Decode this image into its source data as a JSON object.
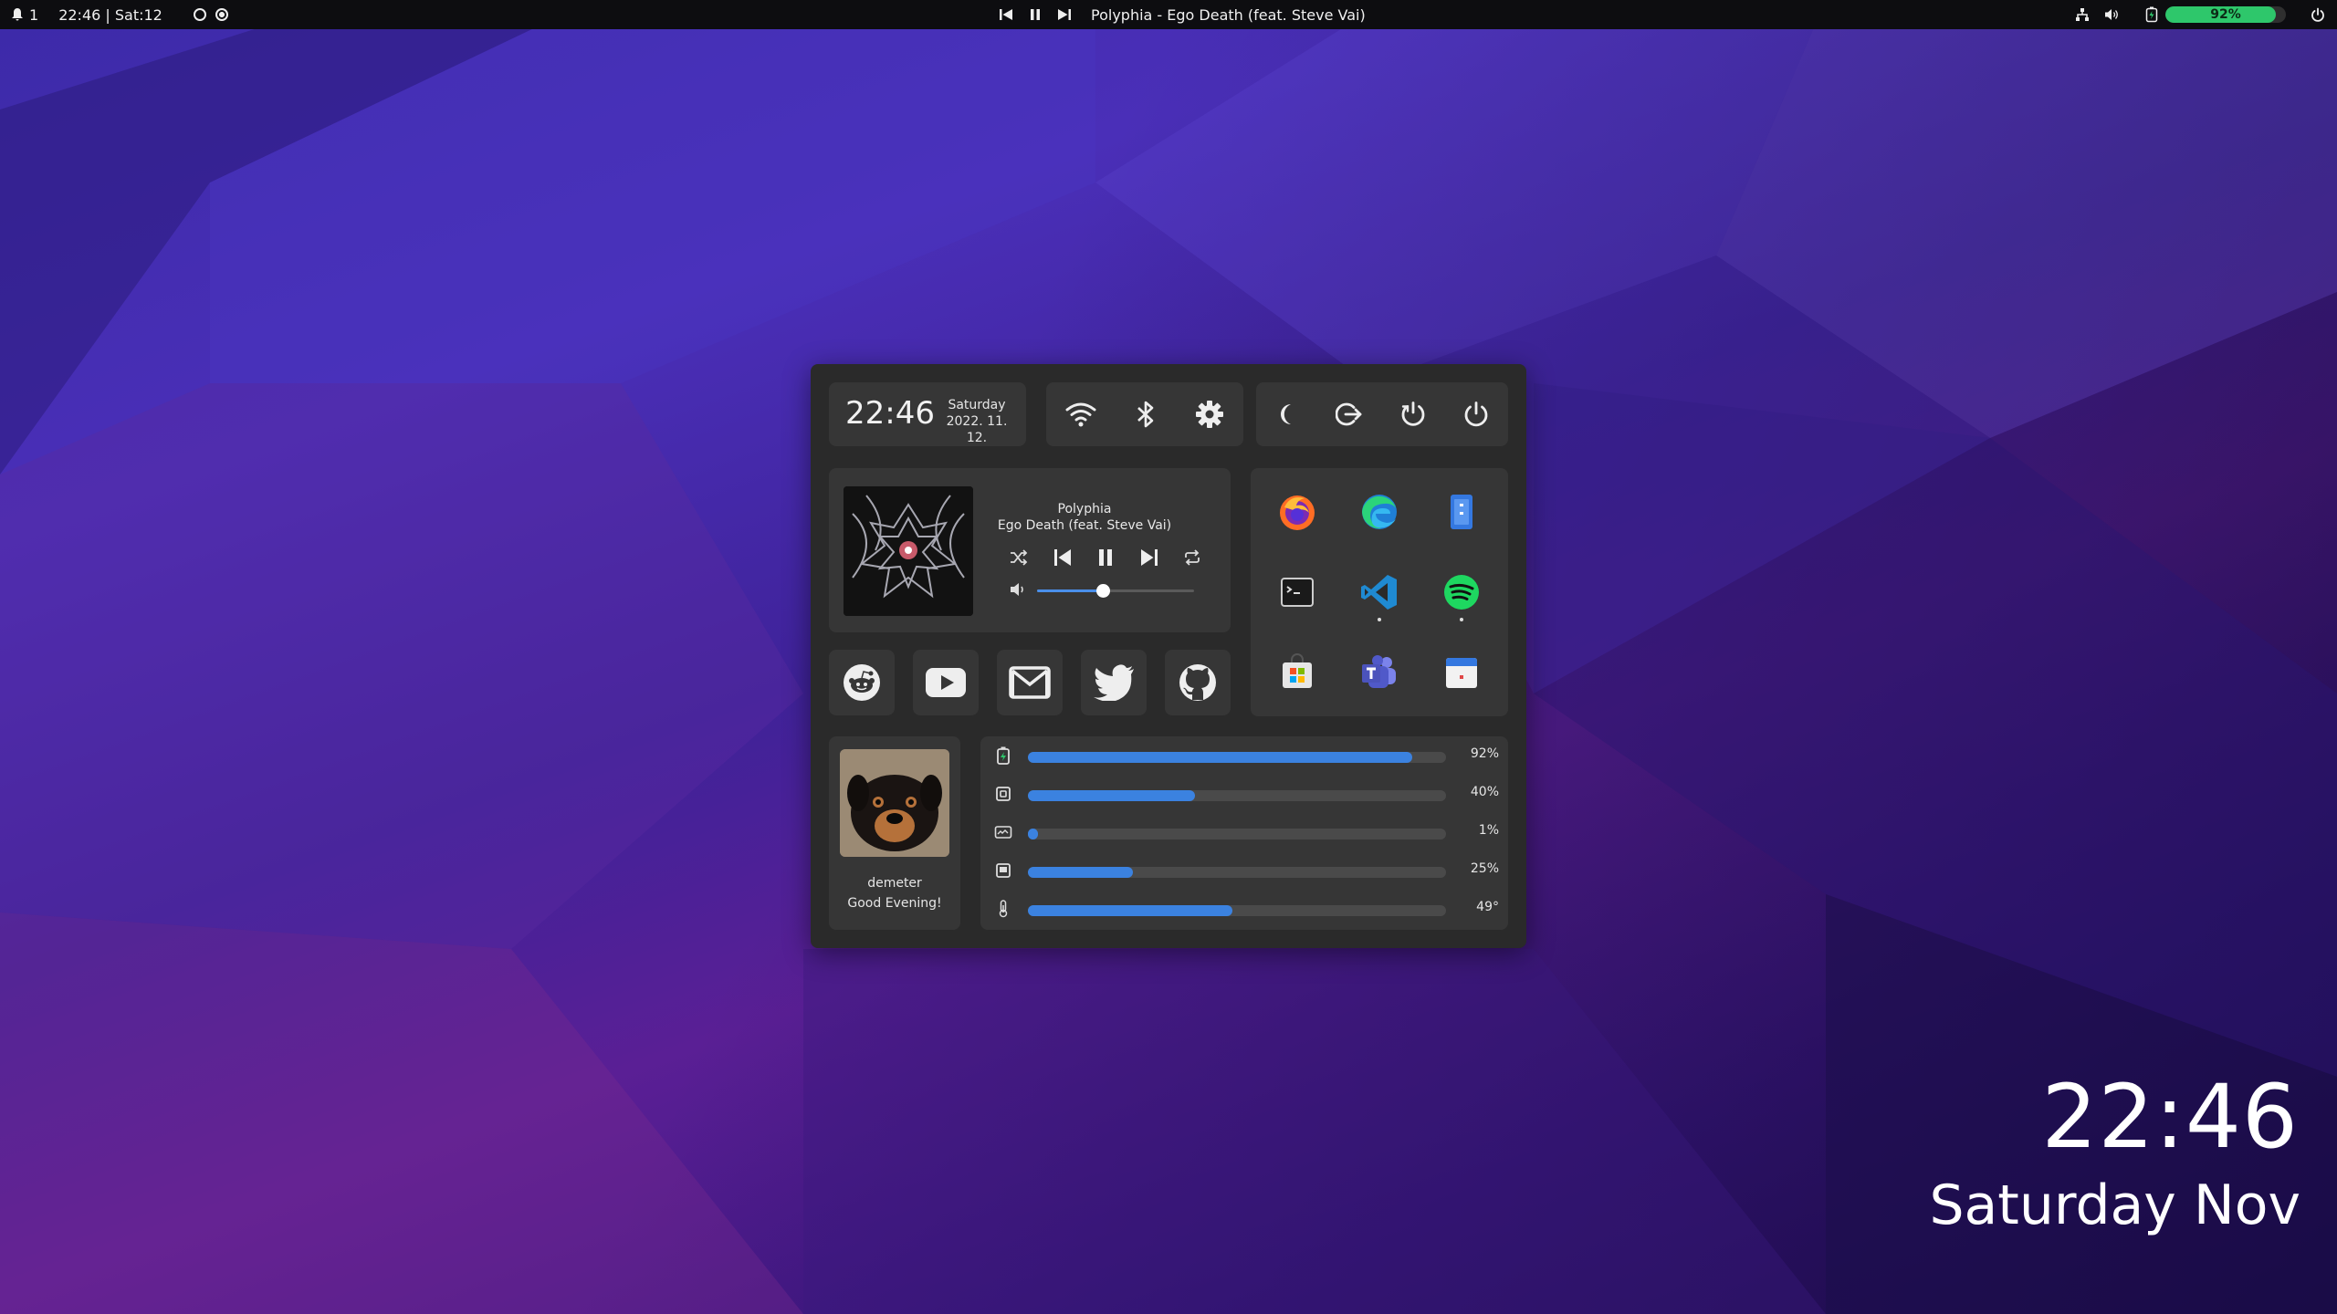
{
  "topbar": {
    "notification_count": "1",
    "clock": "22:46 | Sat:12",
    "now_playing": "Polyphia - Ego Death (feat. Steve Vai)",
    "battery_label": "92%",
    "battery_level": 0.92,
    "battery_color": "#2ec76b"
  },
  "dashboard": {
    "clock": {
      "time": "22:46",
      "day": "Saturday",
      "date": "2022. 11. 12."
    },
    "quick_toggles": [
      "wifi-icon",
      "bluetooth-icon",
      "gear-icon"
    ],
    "power_buttons": [
      "moon-icon",
      "logout-icon",
      "restart-icon",
      "power-icon"
    ],
    "music": {
      "artist": "Polyphia",
      "title": "Ego Death (feat. Steve Vai)",
      "volume_level": 0.42
    },
    "apps": [
      "firefox",
      "edge",
      "files",
      "terminal",
      "vscode",
      "spotify",
      "store",
      "teams",
      "calendar"
    ],
    "web_shortcuts": [
      "reddit-icon",
      "youtube-icon",
      "gmail-icon",
      "twitter-icon",
      "github-icon"
    ],
    "profile": {
      "username": "demeter",
      "greeting": "Good Evening!"
    },
    "stats": [
      {
        "icon": "battery-icon",
        "label": "92%",
        "level": 0.92
      },
      {
        "icon": "cpu-icon",
        "label": "40%",
        "level": 0.4
      },
      {
        "icon": "gpu-icon",
        "label": "1%",
        "level": 0.01
      },
      {
        "icon": "memory-icon",
        "label": "25%",
        "level": 0.25
      },
      {
        "icon": "thermometer-icon",
        "label": "49°",
        "level": 0.49
      }
    ],
    "accent_color": "#3b82e0"
  },
  "desktop_clock": {
    "time": "22:46",
    "date": "Saturday Nov"
  }
}
